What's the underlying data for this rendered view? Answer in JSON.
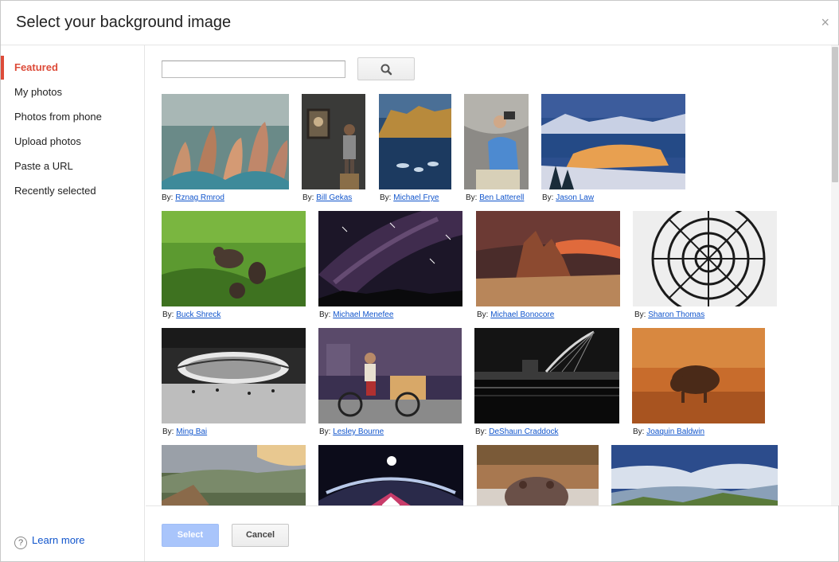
{
  "dialog": {
    "title": "Select your background image",
    "close_symbol": "×"
  },
  "sidebar": {
    "items": [
      {
        "label": "Featured",
        "active": true
      },
      {
        "label": "My photos"
      },
      {
        "label": "Photos from phone"
      },
      {
        "label": "Upload photos"
      },
      {
        "label": "Paste a URL"
      },
      {
        "label": "Recently selected"
      }
    ],
    "help_icon": "?",
    "learn_more": "Learn more"
  },
  "search": {
    "value": "",
    "button_icon": "search-icon"
  },
  "caption_prefix": "By:",
  "photos": [
    {
      "author": "Rznag Rmrod",
      "subject": "plants"
    },
    {
      "author": "Bill Gekas",
      "subject": "child-portrait"
    },
    {
      "author": "Michael Frye",
      "subject": "river-valley"
    },
    {
      "author": "Ben Latterell",
      "subject": "person-camera"
    },
    {
      "author": "Jason Law",
      "subject": "night-city"
    },
    {
      "author": "Buck Shreck",
      "subject": "bears"
    },
    {
      "author": "Michael Menefee",
      "subject": "star-trails"
    },
    {
      "author": "Michael Bonocore",
      "subject": "rock-sunset"
    },
    {
      "author": "Sharon Thomas",
      "subject": "glass-dome"
    },
    {
      "author": "Ming Bai",
      "subject": "stadium"
    },
    {
      "author": "Lesley Bourne",
      "subject": "tricycle"
    },
    {
      "author": "DeShaun Craddock",
      "subject": "bridge-night"
    },
    {
      "author": "Joaquin Baldwin",
      "subject": "bison"
    },
    {
      "author": "",
      "subject": "valley-clouds"
    },
    {
      "author": "",
      "subject": "fisheye-night"
    },
    {
      "author": "",
      "subject": "hippo"
    },
    {
      "author": "",
      "subject": "landscape-sky"
    }
  ],
  "footer": {
    "select_label": "Select",
    "cancel_label": "Cancel"
  },
  "colors": {
    "accent": "#dd4b39",
    "link": "#1155cc",
    "select_button": "#a9c5fb"
  }
}
